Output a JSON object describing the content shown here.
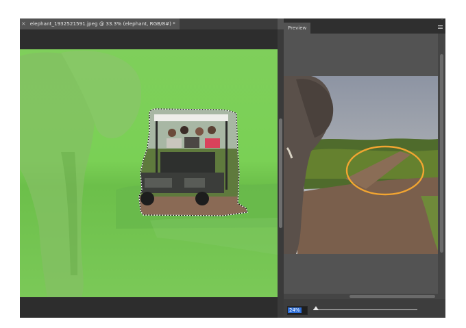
{
  "document": {
    "tab_title": "elephant_1932521591.jpeg @ 33.3% (elephant, RGB/8#) *",
    "close_glyph": "×"
  },
  "preview": {
    "tab_label": "Preview",
    "collapse_glyph": "»",
    "zoom_value": "24%",
    "zoom_level": 0.24
  },
  "colors": {
    "mask_overlay": "#7ed35a",
    "panel_bg": "#535353",
    "highlight_ellipse": "#f2a531",
    "zoom_selection": "#2f6fd8"
  },
  "icons": {
    "panel_menu": "hamburger-menu-icon",
    "collapse": "double-chevron-icon"
  }
}
